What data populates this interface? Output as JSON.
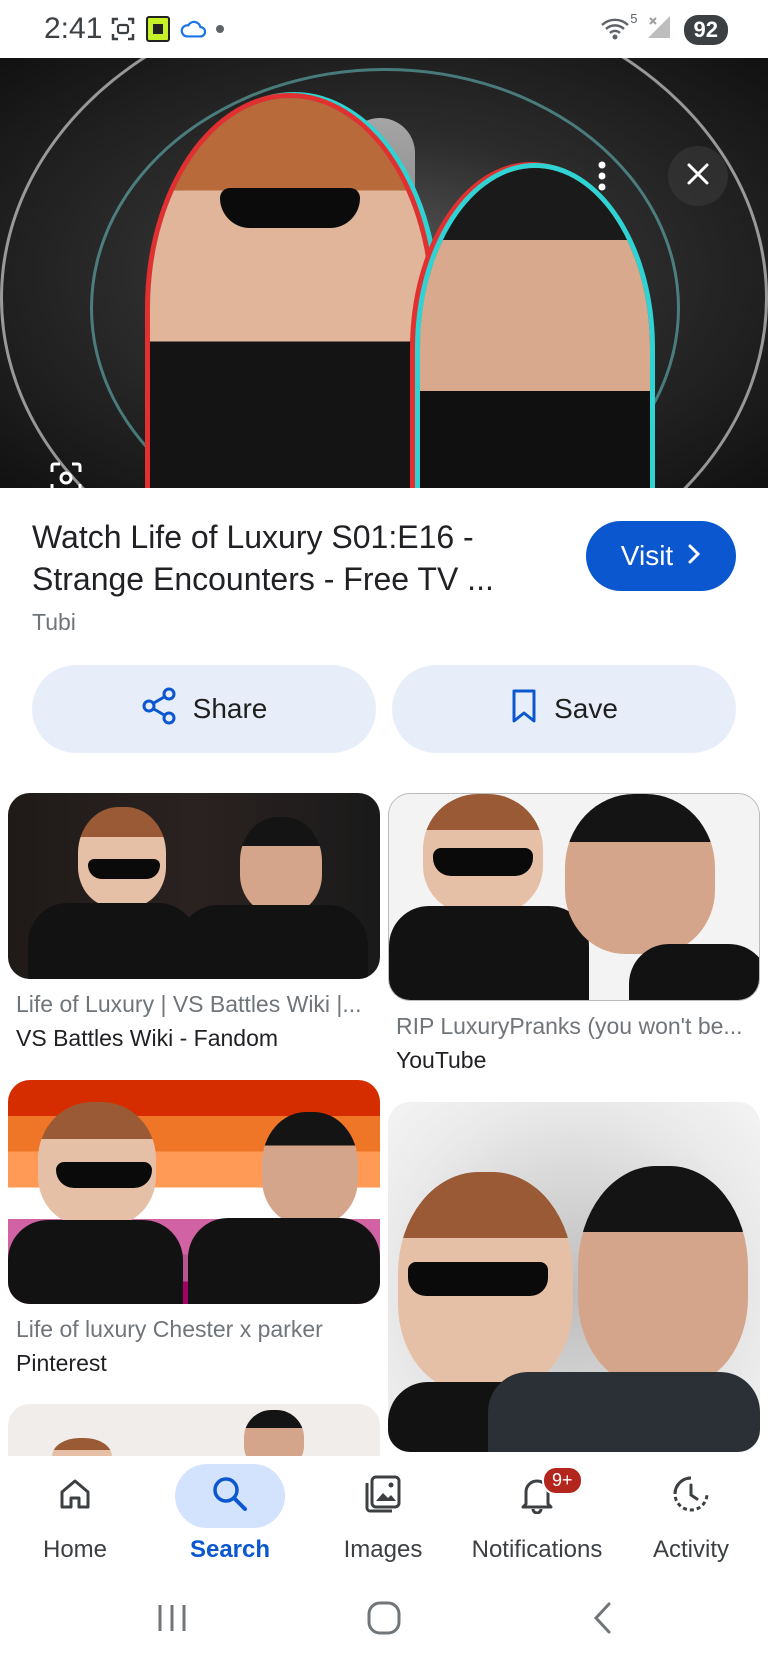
{
  "status_bar": {
    "time": "2:41",
    "wifi_badge": "5",
    "battery": "92"
  },
  "hero": {
    "more_icon": "more-vert-icon",
    "close_icon": "close-icon",
    "lens_icon": "lens-icon"
  },
  "result": {
    "title": "Watch Life of Luxury S01:E16 - Strange Encounters - Free TV ...",
    "source": "Tubi",
    "visit_label": "Visit",
    "share_label": "Share",
    "save_label": "Save"
  },
  "related": [
    {
      "title": "Life of Luxury | VS Battles Wiki |...",
      "source": "VS Battles Wiki - Fandom"
    },
    {
      "title": "RIP LuxuryPranks (you won't be...",
      "source": "YouTube"
    },
    {
      "title": "Life of luxury Chester x parker",
      "source": "Pinterest"
    },
    {
      "title": "",
      "source": ""
    }
  ],
  "bottom_nav": [
    {
      "label": "Home",
      "icon": "home-icon"
    },
    {
      "label": "Search",
      "icon": "search-icon",
      "active": true
    },
    {
      "label": "Images",
      "icon": "images-icon"
    },
    {
      "label": "Notifications",
      "icon": "bell-icon",
      "badge": "9+"
    },
    {
      "label": "Activity",
      "icon": "activity-icon"
    }
  ],
  "colors": {
    "accent": "#0b57d0",
    "pill_bg": "#e8eef9",
    "active_nav_bg": "#d3e3fd",
    "badge": "#b3261e"
  }
}
